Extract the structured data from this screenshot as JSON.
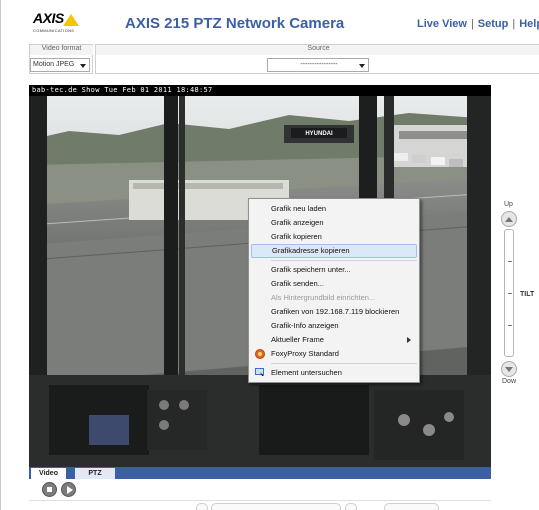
{
  "header": {
    "logo_text": "AXIS",
    "logo_sub": "COMMUNICATIONS",
    "title": "AXIS 215 PTZ Network Camera",
    "nav": {
      "live_view": "Live View",
      "setup": "Setup",
      "help": "Help"
    }
  },
  "controls": {
    "video_format_label": "Video format",
    "video_format_value": "Motion JPEG",
    "source_label": "Source",
    "source_value": "----------------"
  },
  "video": {
    "overlay_text": "bab-tec.de Show Tue Feb 01 2011 18:48:57",
    "sign_text": "HYUNDAI"
  },
  "ptz": {
    "up_label": "Up",
    "tilt_label": "TILT",
    "down_label": "Dow"
  },
  "tabs": [
    {
      "label": "Video",
      "active": true
    },
    {
      "label": "PTZ",
      "active": false
    }
  ],
  "context_menu": {
    "items": [
      {
        "label": "Grafik neu laden",
        "enabled": true
      },
      {
        "label": "Grafik anzeigen",
        "enabled": true
      },
      {
        "label": "Grafik kopieren",
        "enabled": true
      },
      {
        "label": "Grafikadresse kopieren",
        "enabled": true,
        "highlighted": true
      },
      {
        "label": "Grafik speichern unter...",
        "enabled": true
      },
      {
        "label": "Grafik senden...",
        "enabled": true
      },
      {
        "label": "Als Hintergrundbild einrichten...",
        "enabled": false
      },
      {
        "label": "Grafiken von 192.168.7.119 blockieren",
        "enabled": true
      },
      {
        "label": "Grafik-Info anzeigen",
        "enabled": true
      },
      {
        "label": "Aktueller Frame",
        "enabled": true,
        "submenu": true
      },
      {
        "label": "FoxyProxy Standard",
        "enabled": true,
        "icon": "foxyproxy-icon"
      },
      {
        "label": "Element untersuchen",
        "enabled": true,
        "icon": "inspect-icon"
      }
    ]
  },
  "colors": {
    "accent": "#3a5fa5",
    "logo_yellow": "#f6c400",
    "menu_highlight": "#dbe8f9"
  }
}
